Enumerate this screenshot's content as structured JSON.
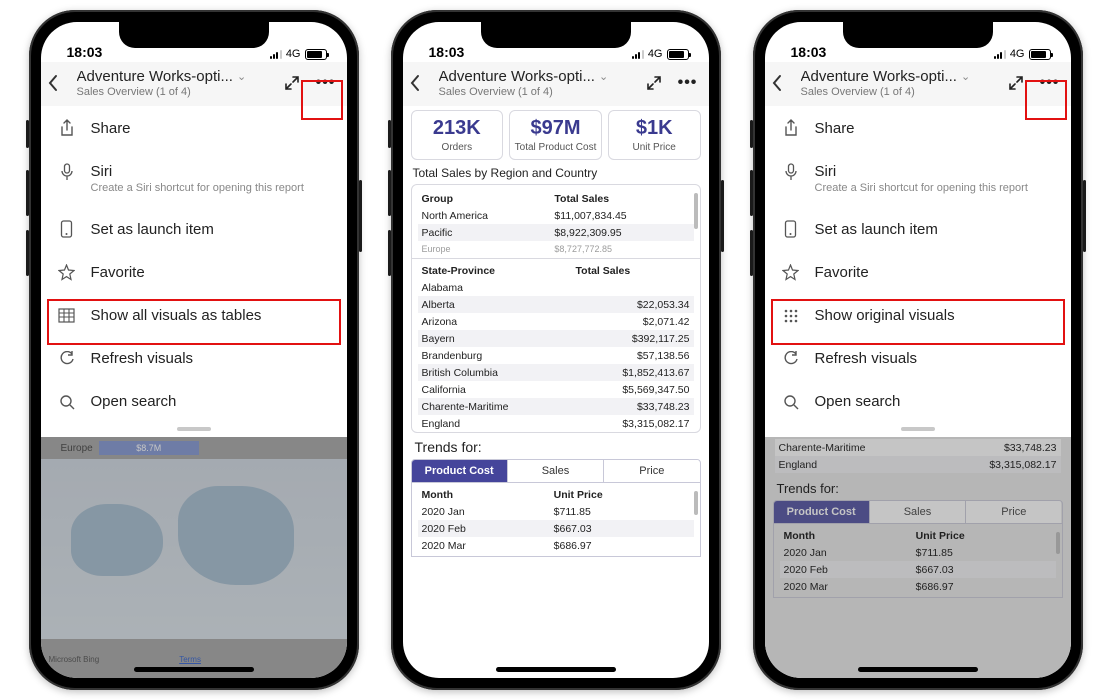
{
  "statusbar": {
    "time": "18:03",
    "network": "4G"
  },
  "header": {
    "title": "Adventure Works-opti...",
    "subtitle": "Sales Overview (1 of 4)"
  },
  "menu": {
    "share": "Share",
    "siri": "Siri",
    "siri_sub": "Create a Siri shortcut for opening this report",
    "launch": "Set as launch item",
    "favorite": "Favorite",
    "show_tables": "Show all visuals as tables",
    "show_original": "Show original visuals",
    "refresh": "Refresh visuals",
    "search": "Open search"
  },
  "kpis": [
    {
      "value": "213K",
      "label": "Orders"
    },
    {
      "value": "$97M",
      "label": "Total Product Cost"
    },
    {
      "value": "$1K",
      "label": "Unit Price"
    }
  ],
  "region_table": {
    "title": "Total Sales by Region and Country",
    "headers": [
      "Group",
      "Total Sales"
    ],
    "rows": [
      [
        "North America",
        "$11,007,834.45"
      ],
      [
        "Pacific",
        "$8,922,309.95"
      ],
      [
        "Europe",
        "$8,727,772.85"
      ]
    ]
  },
  "state_table": {
    "headers": [
      "State-Province",
      "Total Sales"
    ],
    "rows": [
      [
        "Alabama",
        ""
      ],
      [
        "Alberta",
        "$22,053.34"
      ],
      [
        "Arizona",
        "$2,071.42"
      ],
      [
        "Bayern",
        "$392,117.25"
      ],
      [
        "Brandenburg",
        "$57,138.56"
      ],
      [
        "British Columbia",
        "$1,852,413.67"
      ],
      [
        "California",
        "$5,569,347.50"
      ],
      [
        "Charente-Maritime",
        "$33,748.23"
      ],
      [
        "England",
        "$3,315,082.17"
      ]
    ]
  },
  "trends": {
    "title": "Trends for:",
    "tabs": [
      "Product Cost",
      "Sales",
      "Price"
    ],
    "headers": [
      "Month",
      "Unit Price"
    ],
    "rows": [
      [
        "2020 Jan",
        "$711.85"
      ],
      [
        "2020 Feb",
        "$667.03"
      ],
      [
        "2020 Mar",
        "$686.97"
      ]
    ]
  },
  "bg_phone1": {
    "bar_label": "Europe",
    "bar_value": "$8.7M",
    "footer_brand": "Microsoft Bing",
    "footer_terms": "Terms"
  },
  "bg_phone3": {
    "rows": [
      [
        "Charente-Maritime",
        "$33,748.23"
      ],
      [
        "England",
        "$3,315,082.17"
      ]
    ]
  },
  "chart_data": [
    {
      "type": "table",
      "title": "KPI cards",
      "categories": [
        "Orders",
        "Total Product Cost",
        "Unit Price"
      ],
      "values": [
        "213K",
        "$97M",
        "$1K"
      ]
    },
    {
      "type": "table",
      "title": "Total Sales by Region and Country — Group",
      "columns": [
        "Group",
        "Total Sales"
      ],
      "rows": [
        [
          "North America",
          "$11,007,834.45"
        ],
        [
          "Pacific",
          "$8,922,309.95"
        ],
        [
          "Europe",
          "$8,727,772.85"
        ]
      ]
    },
    {
      "type": "table",
      "title": "Total Sales by State-Province",
      "columns": [
        "State-Province",
        "Total Sales"
      ],
      "rows": [
        [
          "Alabama",
          ""
        ],
        [
          "Alberta",
          "$22,053.34"
        ],
        [
          "Arizona",
          "$2,071.42"
        ],
        [
          "Bayern",
          "$392,117.25"
        ],
        [
          "Brandenburg",
          "$57,138.56"
        ],
        [
          "British Columbia",
          "$1,852,413.67"
        ],
        [
          "California",
          "$5,569,347.50"
        ],
        [
          "Charente-Maritime",
          "$33,748.23"
        ],
        [
          "England",
          "$3,315,082.17"
        ]
      ]
    },
    {
      "type": "table",
      "title": "Trends for: Product Cost",
      "columns": [
        "Month",
        "Unit Price"
      ],
      "rows": [
        [
          "2020 Jan",
          "$711.85"
        ],
        [
          "2020 Feb",
          "$667.03"
        ],
        [
          "2020 Mar",
          "$686.97"
        ]
      ]
    }
  ]
}
